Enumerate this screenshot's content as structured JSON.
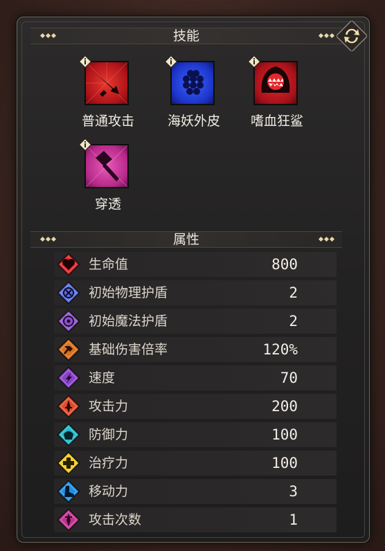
{
  "skills_header": {
    "title": "技能"
  },
  "skills": [
    {
      "name": "普通攻击",
      "icon": "sword-thrust-icon",
      "color": "#c4161c"
    },
    {
      "name": "海妖外皮",
      "icon": "scales-icon",
      "color": "#1f3fd6"
    },
    {
      "name": "嗜血狂鲨",
      "icon": "shark-jaws-icon",
      "color": "#b5121b"
    },
    {
      "name": "穿透",
      "icon": "hammer-pierce-icon",
      "color": "#c0338f"
    }
  ],
  "attributes_header": {
    "title": "属性"
  },
  "attributes": [
    {
      "label": "生命值",
      "value": "800",
      "icon": "heart-icon",
      "color": "#e0222a"
    },
    {
      "label": "初始物理护盾",
      "value": "2",
      "icon": "physical-shield-icon",
      "color": "#5a6fe0"
    },
    {
      "label": "初始魔法护盾",
      "value": "2",
      "icon": "magic-shield-icon",
      "color": "#8a52c8"
    },
    {
      "label": "基础伤害倍率",
      "value": "120%",
      "icon": "damage-multiplier-icon",
      "color": "#d8701e"
    },
    {
      "label": "速度",
      "value": "70",
      "icon": "speed-icon",
      "color": "#8a40c8"
    },
    {
      "label": "攻击力",
      "value": "200",
      "icon": "attack-icon",
      "color": "#e04a2a"
    },
    {
      "label": "防御力",
      "value": "100",
      "icon": "defense-icon",
      "color": "#1fb8c8"
    },
    {
      "label": "治疗力",
      "value": "100",
      "icon": "heal-icon",
      "color": "#f0c81e"
    },
    {
      "label": "移动力",
      "value": "3",
      "icon": "boot-icon",
      "color": "#1e8fe0"
    },
    {
      "label": "攻击次数",
      "value": "1",
      "icon": "attack-count-icon",
      "color": "#c0338f"
    }
  ]
}
